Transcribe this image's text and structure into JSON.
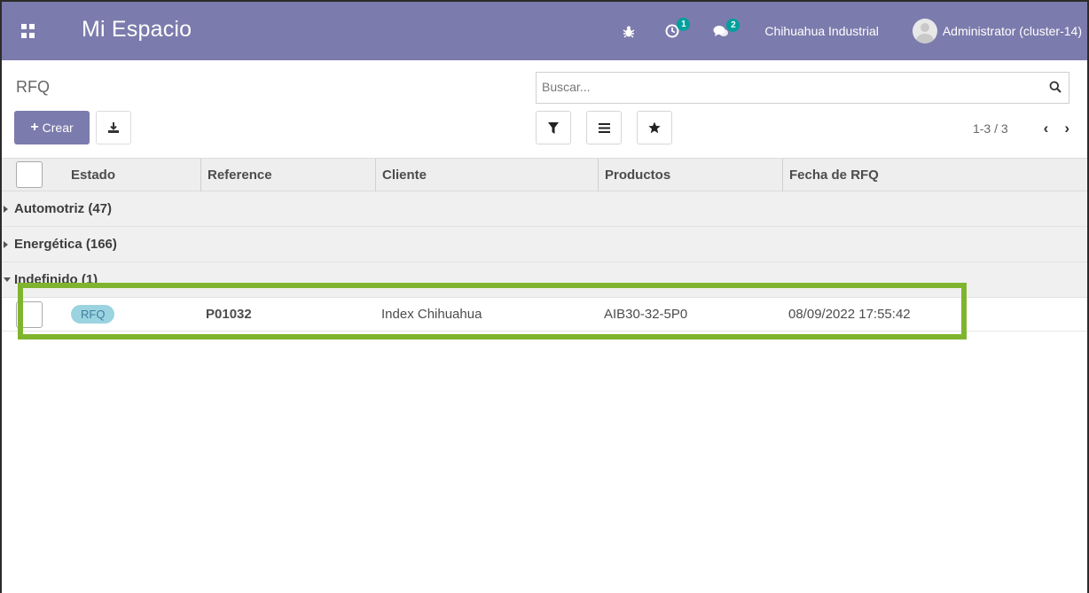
{
  "navbar": {
    "app_title": "Mi Espacio",
    "activity_badge": "1",
    "messages_badge": "2",
    "company": "Chihuahua Industrial",
    "user": "Administrator (cluster-14)",
    "accent_color": "#7c7bad"
  },
  "control_panel": {
    "breadcrumb": "RFQ",
    "create_label": "Crear",
    "search_placeholder": "Buscar...",
    "pager_value": "1-3 / 3"
  },
  "table": {
    "columns": [
      "Estado",
      "Reference",
      "Cliente",
      "Productos",
      "Fecha de RFQ"
    ],
    "groups": [
      {
        "label": "Automotriz (47)",
        "expanded": false
      },
      {
        "label": "Energética (166)",
        "expanded": false
      },
      {
        "label": "Indefinido (1)",
        "expanded": true
      }
    ],
    "rows": [
      {
        "estado": "RFQ",
        "reference": "P01032",
        "cliente": "Index Chihuahua",
        "productos": "AIB30-32-5P0",
        "fecha": "08/09/2022 17:55:42"
      }
    ]
  },
  "highlight_color": "#7fb52e"
}
